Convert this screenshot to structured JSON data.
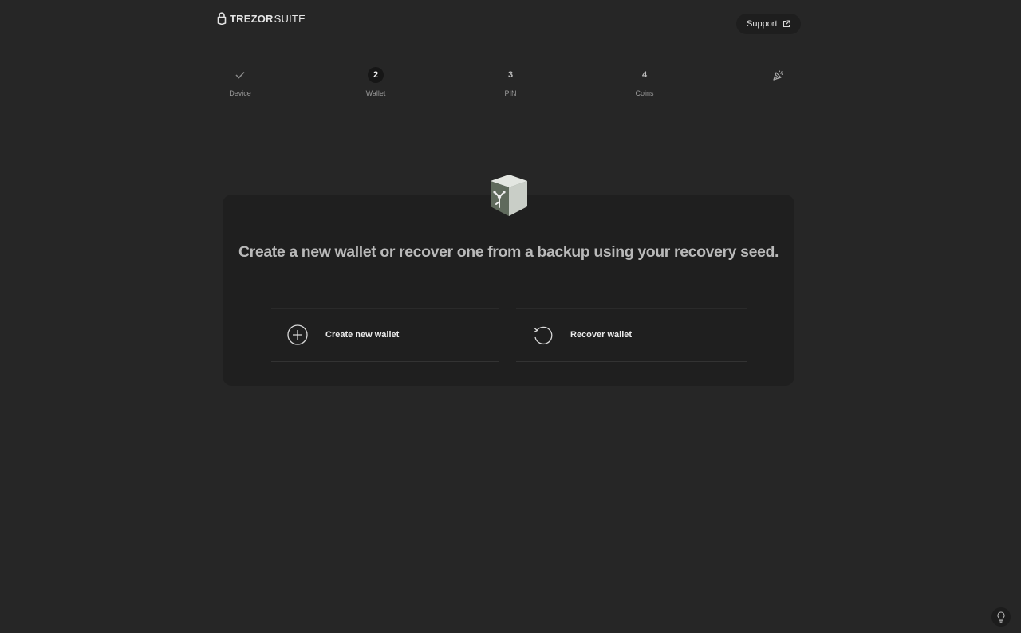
{
  "header": {
    "logo_bold": "TREZOR",
    "logo_light": "SUITE",
    "support_label": "Support"
  },
  "steps": [
    {
      "mark": "",
      "label": "Device",
      "state": "done"
    },
    {
      "mark": "2",
      "label": "Wallet",
      "state": "active"
    },
    {
      "mark": "3",
      "label": "PIN",
      "state": "upcoming"
    },
    {
      "mark": "4",
      "label": "Coins",
      "state": "upcoming"
    },
    {
      "mark": "",
      "label": "",
      "state": "final"
    }
  ],
  "main": {
    "headline": "Create a new wallet or recover one from a backup using your recovery seed.",
    "options": [
      {
        "label": "Create new wallet",
        "icon": "plus-circle-icon"
      },
      {
        "label": "Recover wallet",
        "icon": "rotate-ccw-icon"
      }
    ]
  },
  "colors": {
    "background": "#262626",
    "card": "#1f1f1f",
    "text_primary": "#ececec",
    "text_secondary": "#9a9a9a"
  }
}
